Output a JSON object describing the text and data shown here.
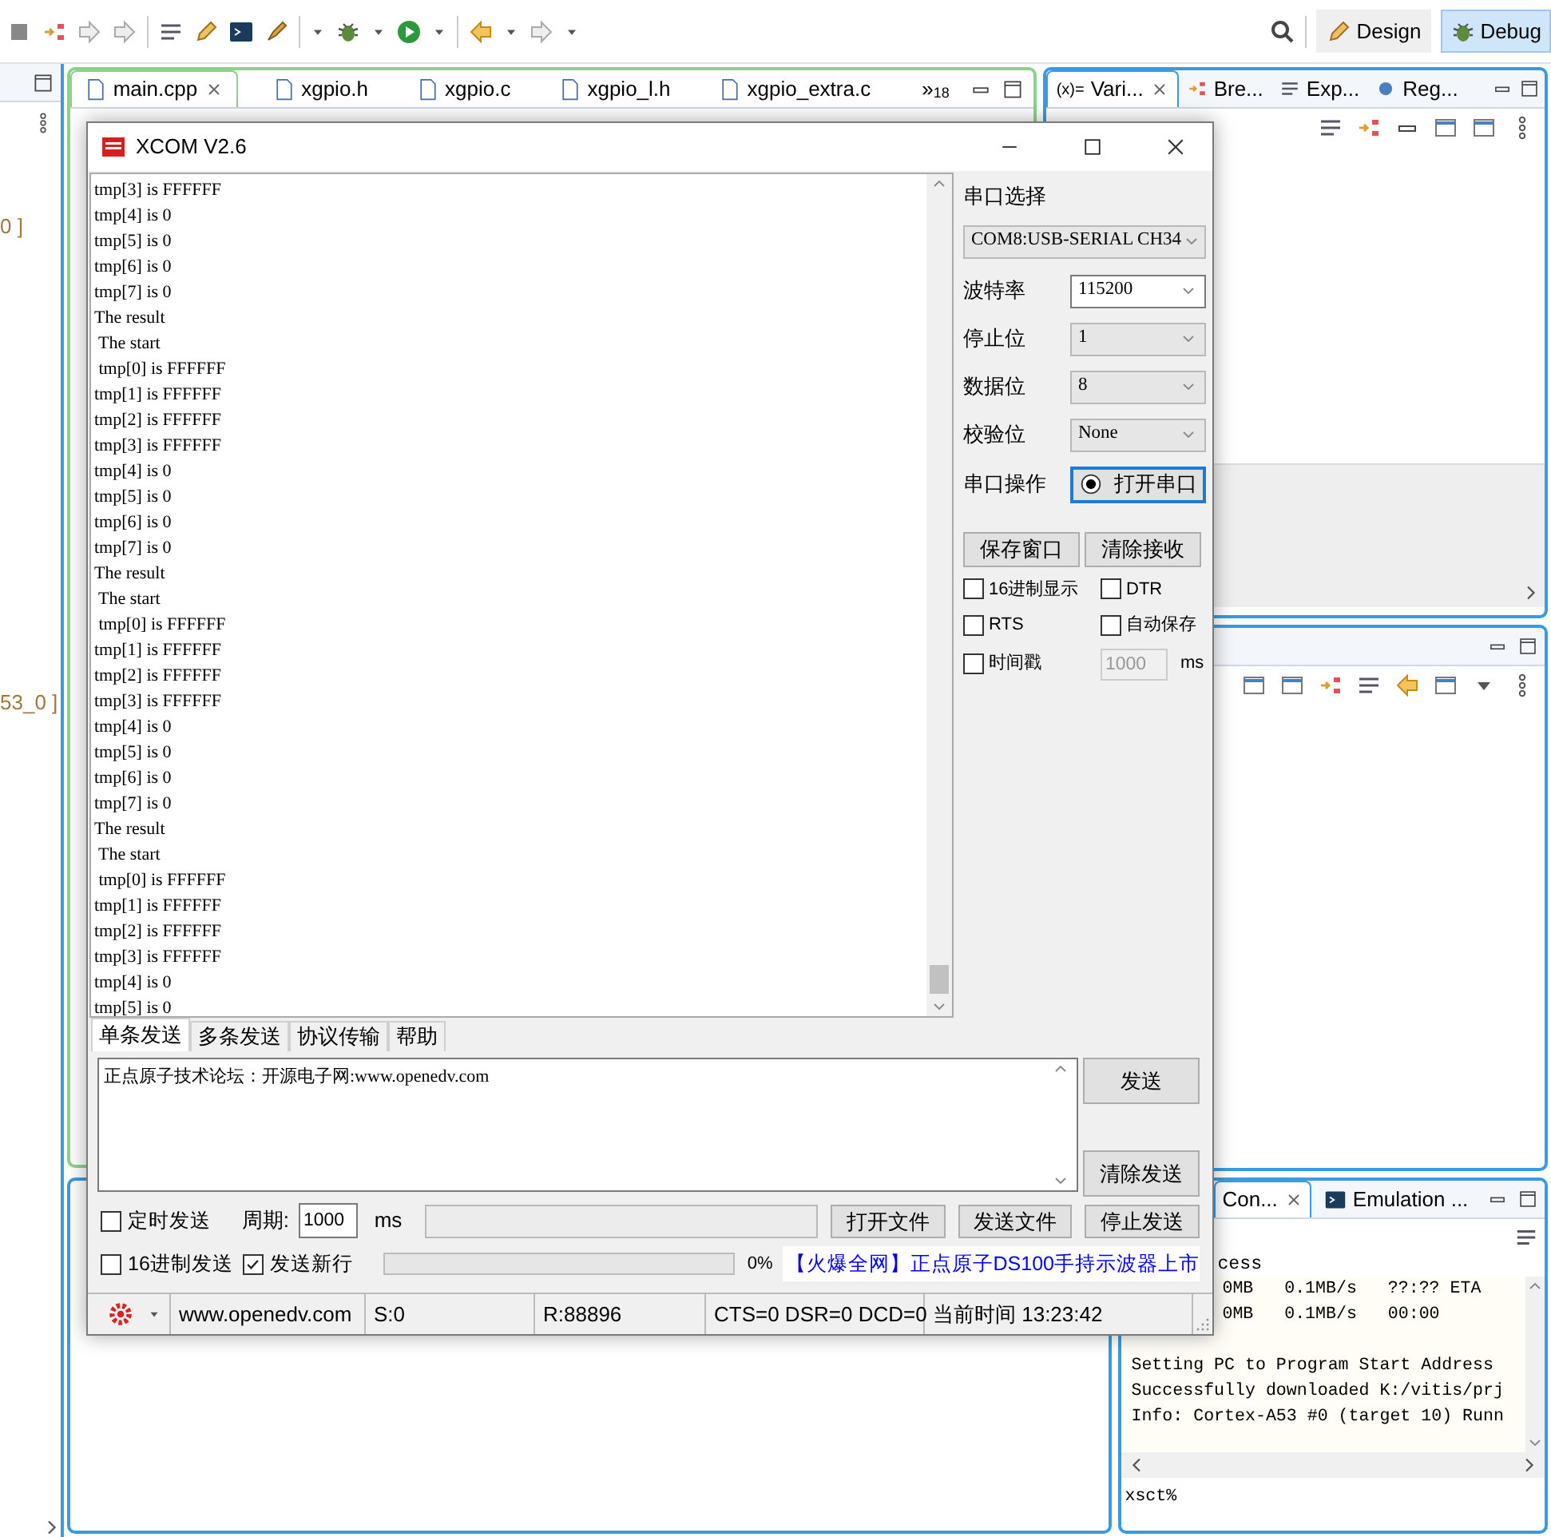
{
  "ide": {
    "perspectives": [
      {
        "label": "Design",
        "selected": false
      },
      {
        "label": "Debug",
        "selected": true
      }
    ],
    "left_panel": {
      "labels": [
        "0 ]",
        "53_0 ]"
      ]
    },
    "editor": {
      "tabs": [
        {
          "label": "main.cpp",
          "selected": true
        },
        {
          "label": "xgpio.h",
          "selected": false
        },
        {
          "label": "xgpio.c",
          "selected": false
        },
        {
          "label": "xgpio_l.h",
          "selected": false
        },
        {
          "label": "xgpio_extra.c",
          "selected": false
        }
      ],
      "overflow": "»",
      "overflow_count": "18"
    },
    "right_panel": {
      "tabs": [
        {
          "label": "Vari...",
          "prefix": "(x)=",
          "selected": true
        },
        {
          "label": "Bre...",
          "selected": false
        },
        {
          "label": "Exp...",
          "selected": false
        },
        {
          "label": "Reg...",
          "selected": false
        }
      ]
    },
    "console": {
      "tabs": [
        {
          "label": "Con...",
          "selected": true
        },
        {
          "label": "Emulation ...",
          "selected": false
        }
      ],
      "heading": "cess",
      "progress_lines": [
        "0MB   0.1MB/s   ??:?? ETA",
        "0MB   0.1MB/s   00:00"
      ],
      "lines": [
        "Setting PC to Program Start Address",
        "Successfully downloaded K:/vitis/prj",
        "Info: Cortex-A53 #0 (target 10) Runn"
      ],
      "prompt": "xsct%"
    }
  },
  "xcom": {
    "title": "XCOM V2.6",
    "receive_lines": [
      "tmp[3] is FFFFFF",
      "tmp[4] is 0",
      "tmp[5] is 0",
      "tmp[6] is 0",
      "tmp[7] is 0",
      "The result",
      " The start",
      " tmp[0] is FFFFFF",
      "tmp[1] is FFFFFF",
      "tmp[2] is FFFFFF",
      "tmp[3] is FFFFFF",
      "tmp[4] is 0",
      "tmp[5] is 0",
      "tmp[6] is 0",
      "tmp[7] is 0",
      "The result",
      " The start",
      " tmp[0] is FFFFFF",
      "tmp[1] is FFFFFF",
      "tmp[2] is FFFFFF",
      "tmp[3] is FFFFFF",
      "tmp[4] is 0",
      "tmp[5] is 0",
      "tmp[6] is 0",
      "tmp[7] is 0",
      "The result",
      " The start",
      " tmp[0] is FFFFFF",
      "tmp[1] is FFFFFF",
      "tmp[2] is FFFFFF",
      "tmp[3] is FFFFFF",
      "tmp[4] is 0",
      "tmp[5] is 0"
    ],
    "port": {
      "label": "串口选择",
      "value": "COM8:USB-SERIAL CH34"
    },
    "settings": [
      {
        "label": "波特率",
        "value": "115200",
        "kind": "editable"
      },
      {
        "label": "停止位",
        "value": "1",
        "kind": "list"
      },
      {
        "label": "数据位",
        "value": "8",
        "kind": "list"
      },
      {
        "label": "校验位",
        "value": "None",
        "kind": "list"
      }
    ],
    "port_action": {
      "label": "串口操作",
      "button": "打开串口"
    },
    "receive_buttons": [
      "保存窗口",
      "清除接收"
    ],
    "options": [
      {
        "label": "16进制显示",
        "checked": false
      },
      {
        "label": "DTR",
        "checked": false
      },
      {
        "label": "RTS",
        "checked": false
      },
      {
        "label": "自动保存",
        "checked": false
      },
      {
        "label": "时间戳",
        "checked": false
      }
    ],
    "timestamp_interval": {
      "value": "1000",
      "unit": "ms",
      "disabled": true
    },
    "tabs": [
      {
        "label": "单条发送",
        "selected": true
      },
      {
        "label": "多条发送",
        "selected": false
      },
      {
        "label": "协议传输",
        "selected": false
      },
      {
        "label": "帮助",
        "selected": false
      }
    ],
    "send_text": "正点原子技术论坛：开源电子网:www.openedv.com",
    "send_buttons": [
      "发送",
      "清除发送"
    ],
    "timed_send": {
      "label": "定时发送",
      "checked": false
    },
    "period": {
      "label": "周期:",
      "value": "1000",
      "unit": "ms"
    },
    "file_buttons": [
      "打开文件",
      "发送文件",
      "停止发送"
    ],
    "hex_send": {
      "label": "16进制发送",
      "checked": false
    },
    "send_newline": {
      "label": "发送新行",
      "checked": true
    },
    "progress": {
      "level": 0,
      "reading": "0%"
    },
    "ad": "【火爆全网】正点原子DS100手持示波器上市",
    "status": [
      "www.openedv.com",
      "S:0",
      "R:88896",
      "CTS=0 DSR=0 DCD=0",
      "当前时间 13:23:42"
    ]
  }
}
